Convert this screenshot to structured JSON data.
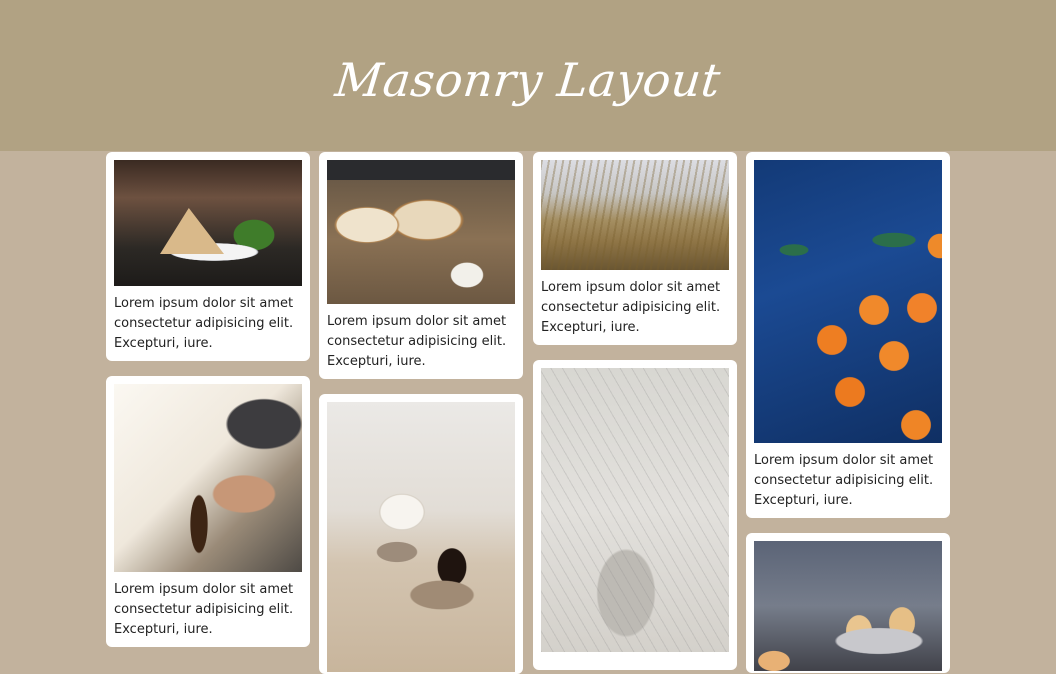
{
  "header": {
    "title": "Masonry Layout"
  },
  "cards": [
    {
      "image": "sandwich-plate-photo",
      "text": "Lorem ipsum dolor sit amet consectetur adipisicing elit. Excepturi, iure."
    },
    {
      "image": "drinks-on-table-photo",
      "text": "Lorem ipsum dolor sit amet consectetur adipisicing elit. Excepturi, iure."
    },
    {
      "image": "bread-and-olive-oil-photo",
      "text": "Lorem ipsum dolor sit amet consectetur adipisicing elit. Excepturi, iure."
    },
    {
      "image": "coffee-cups-photo",
      "text": ""
    },
    {
      "image": "wheat-field-photo",
      "text": "Lorem ipsum dolor sit amet consectetur adipisicing elit. Excepturi, iure."
    },
    {
      "image": "plant-shadow-wall-photo",
      "text": ""
    },
    {
      "image": "oranges-on-blue-photo",
      "text": "Lorem ipsum dolor sit amet consectetur adipisicing elit. Excepturi, iure."
    },
    {
      "image": "cupcakes-photo",
      "text": ""
    }
  ],
  "colors": {
    "page_background": "#c2b29d",
    "header_background": "#b1a283",
    "card_background": "#ffffff",
    "text": "#222222"
  }
}
